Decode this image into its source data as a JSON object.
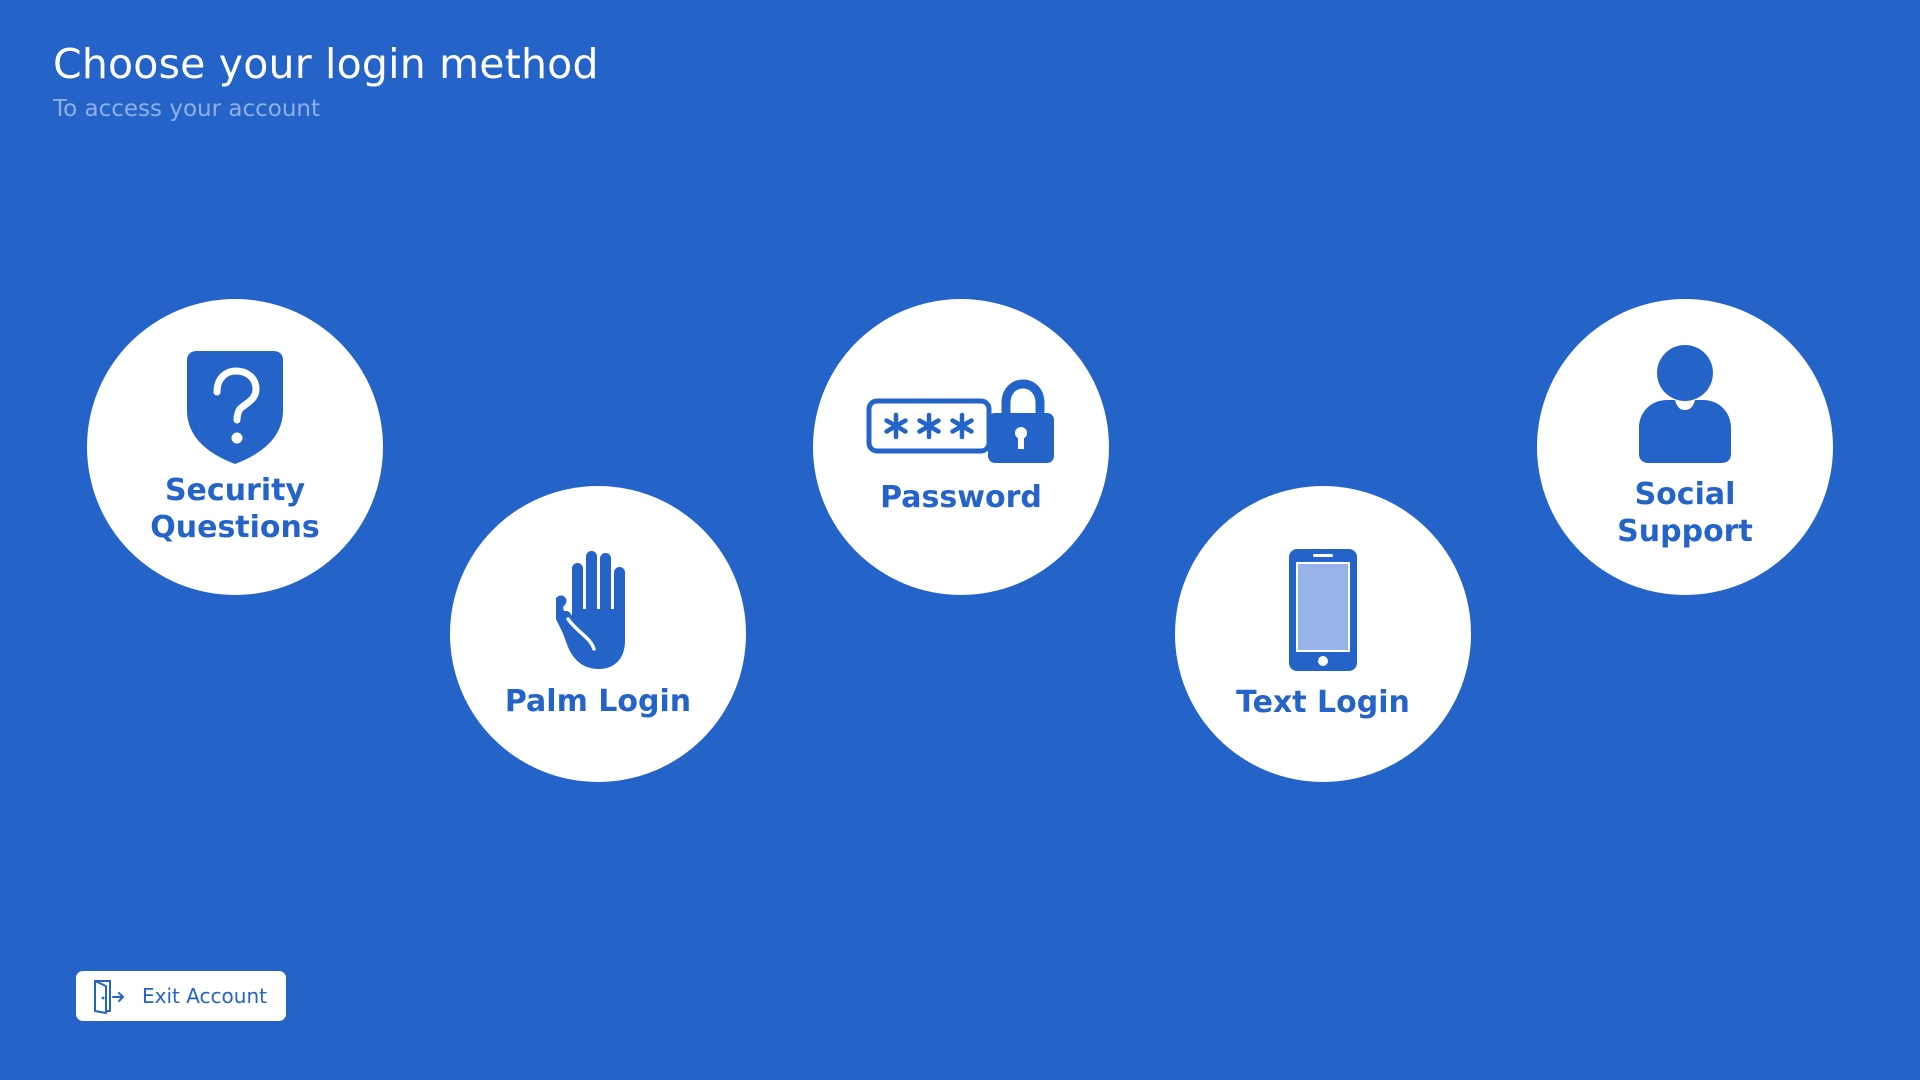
{
  "header": {
    "title": "Choose your login method",
    "subtitle": "To access your account"
  },
  "options": [
    {
      "label": "Security\nQuestions",
      "icon": "shield-question-icon"
    },
    {
      "label": "Palm Login",
      "icon": "hand-icon"
    },
    {
      "label": "Password",
      "icon": "password-lock-icon"
    },
    {
      "label": "Text Login",
      "icon": "smartphone-icon"
    },
    {
      "label": "Social\nSupport",
      "icon": "user-icon"
    }
  ],
  "exit": {
    "label": "Exit Account",
    "icon": "exit-door-icon"
  },
  "colors": {
    "background": "#2463C8",
    "accent": "#2463C8",
    "subtitle": "#8FB0E6",
    "card": "#FFFFFF"
  }
}
